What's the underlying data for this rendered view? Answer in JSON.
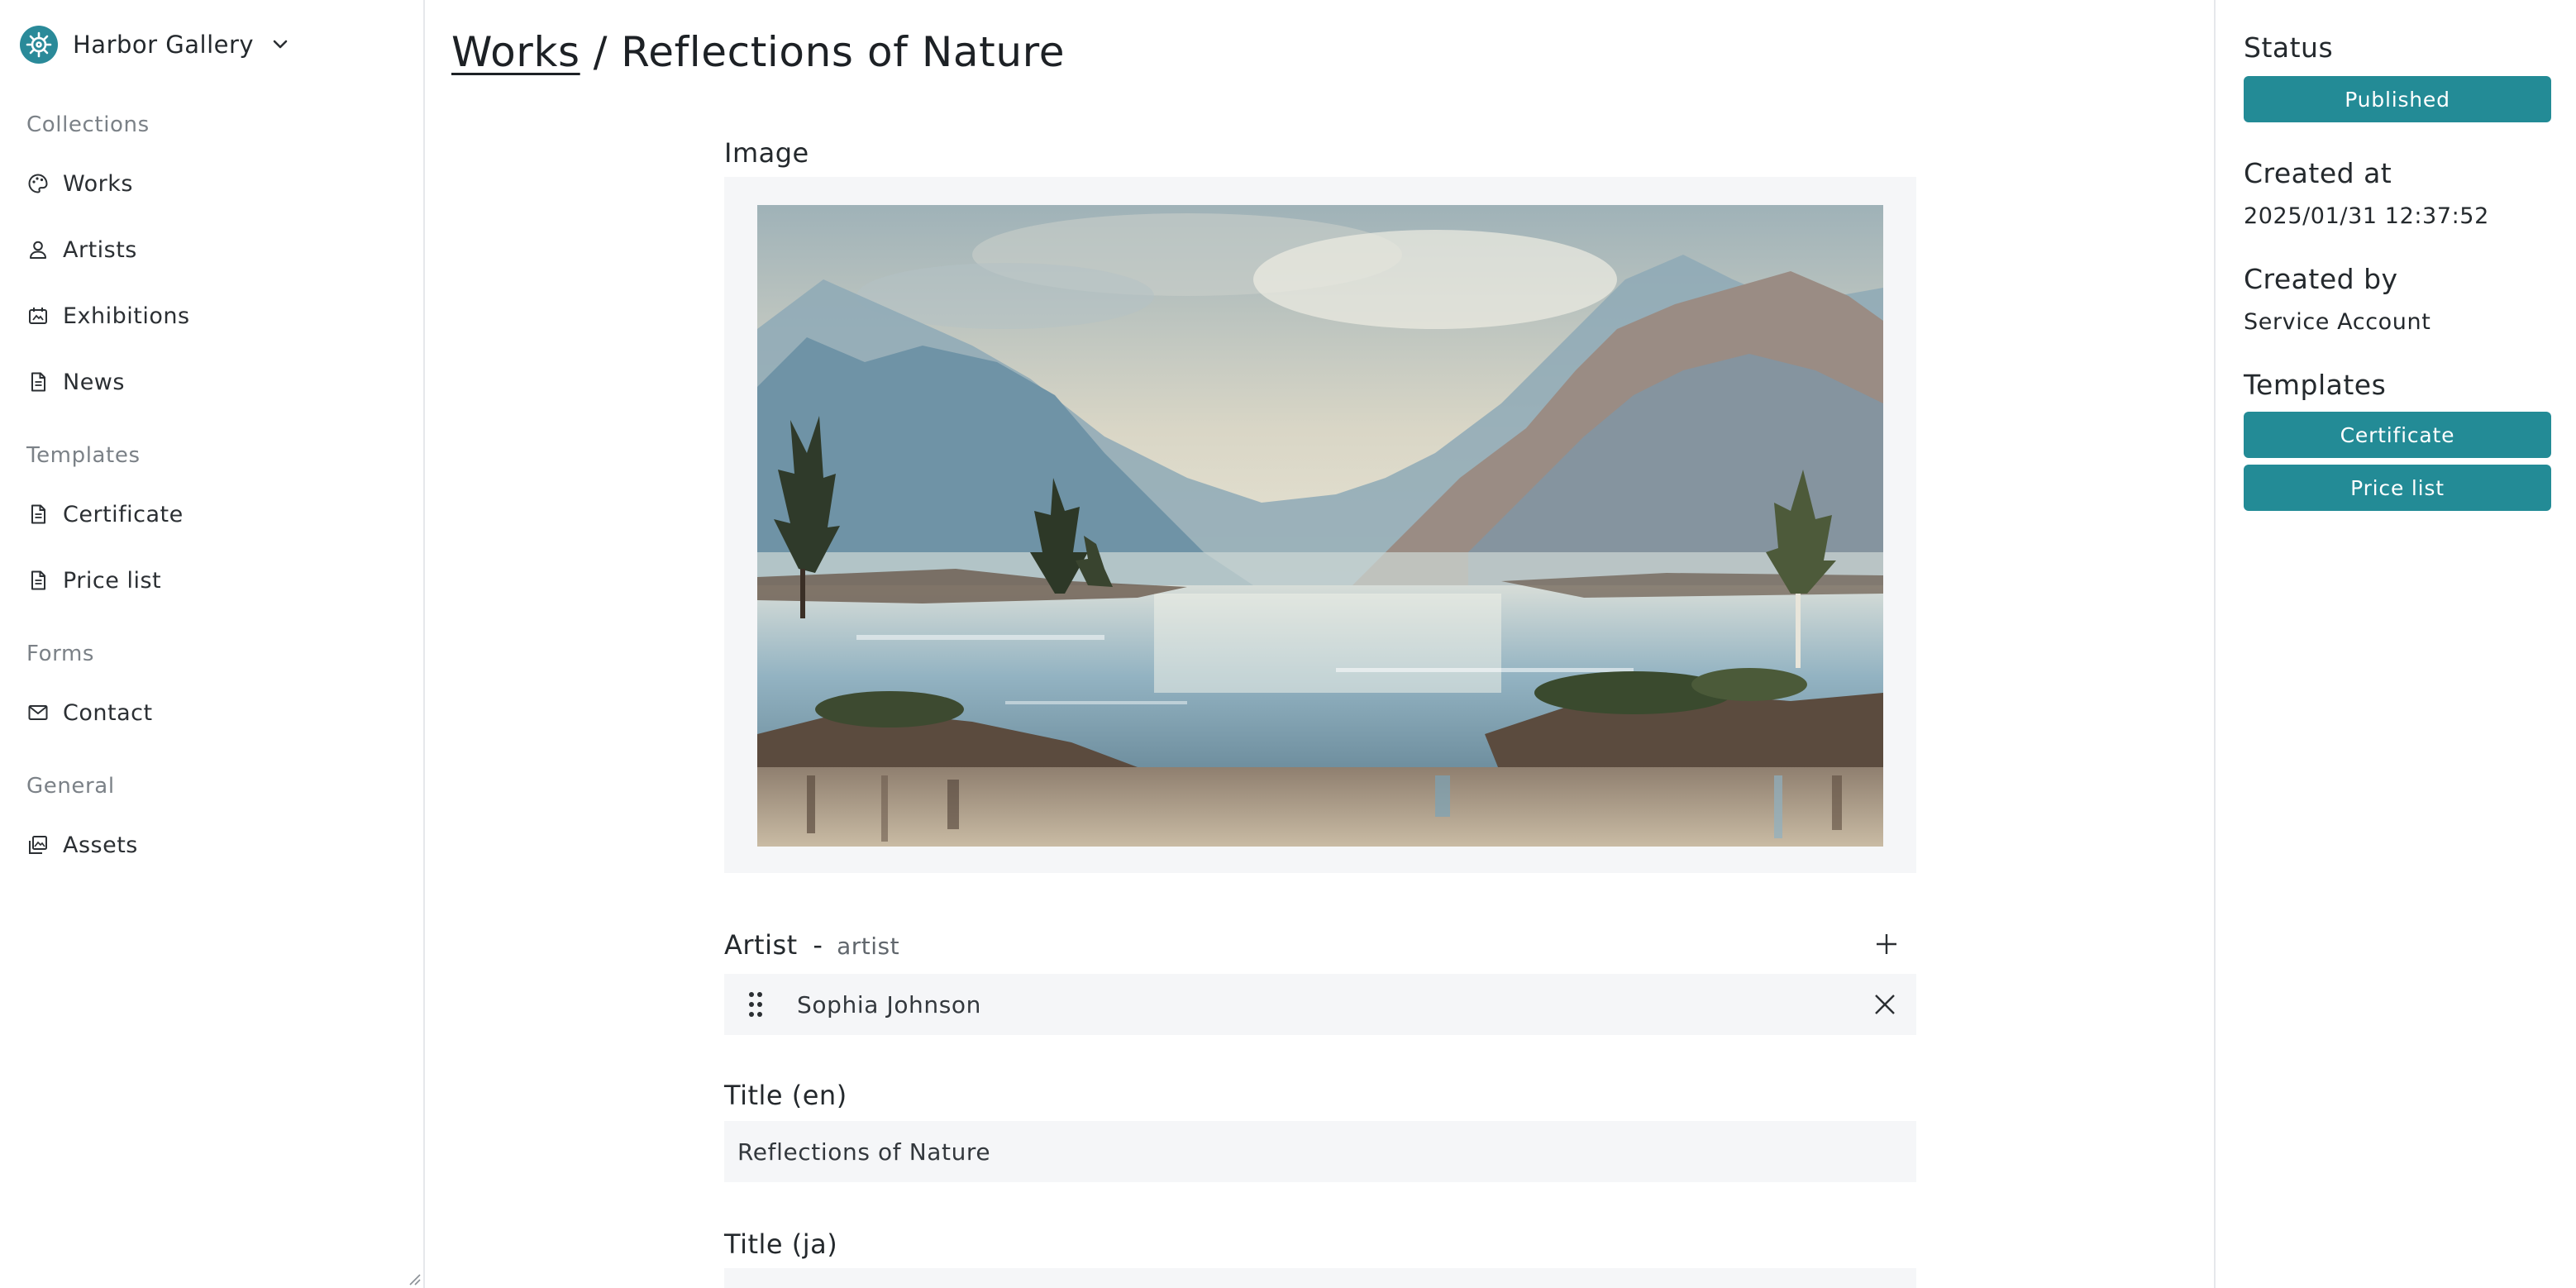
{
  "app": {
    "workspace_name": "Harbor Gallery"
  },
  "sidebar": {
    "sections": [
      {
        "title": "Collections",
        "items": [
          {
            "label": "Works",
            "icon": "palette-icon"
          },
          {
            "label": "Artists",
            "icon": "user-icon"
          },
          {
            "label": "Exhibitions",
            "icon": "calendar-icon"
          },
          {
            "label": "News",
            "icon": "document-icon"
          }
        ]
      },
      {
        "title": "Templates",
        "items": [
          {
            "label": "Certificate",
            "icon": "document-icon"
          },
          {
            "label": "Price list",
            "icon": "document-icon"
          }
        ]
      },
      {
        "title": "Forms",
        "items": [
          {
            "label": "Contact",
            "icon": "envelope-icon"
          }
        ]
      },
      {
        "title": "General",
        "items": [
          {
            "label": "Assets",
            "icon": "images-icon"
          }
        ]
      }
    ]
  },
  "breadcrumb": {
    "parent": "Works",
    "separator": "/",
    "current": "Reflections of Nature"
  },
  "form": {
    "image_label": "Image",
    "artist_label": "Artist",
    "artist_separator": "-",
    "artist_key": "artist",
    "artist_value": "Sophia Johnson",
    "title_en_label": "Title (en)",
    "title_en_value": "Reflections of Nature",
    "title_ja_label": "Title (ja)",
    "title_ja_value": ""
  },
  "meta": {
    "status_label": "Status",
    "status_value": "Published",
    "created_at_label": "Created at",
    "created_at_value": "2025/01/31 12:37:52",
    "created_by_label": "Created by",
    "created_by_value": "Service Account",
    "templates_label": "Templates",
    "templates": [
      "Certificate",
      "Price list"
    ]
  },
  "colors": {
    "accent": "#238b96",
    "field_bg": "#f5f6f8",
    "border": "#e6e8eb"
  }
}
